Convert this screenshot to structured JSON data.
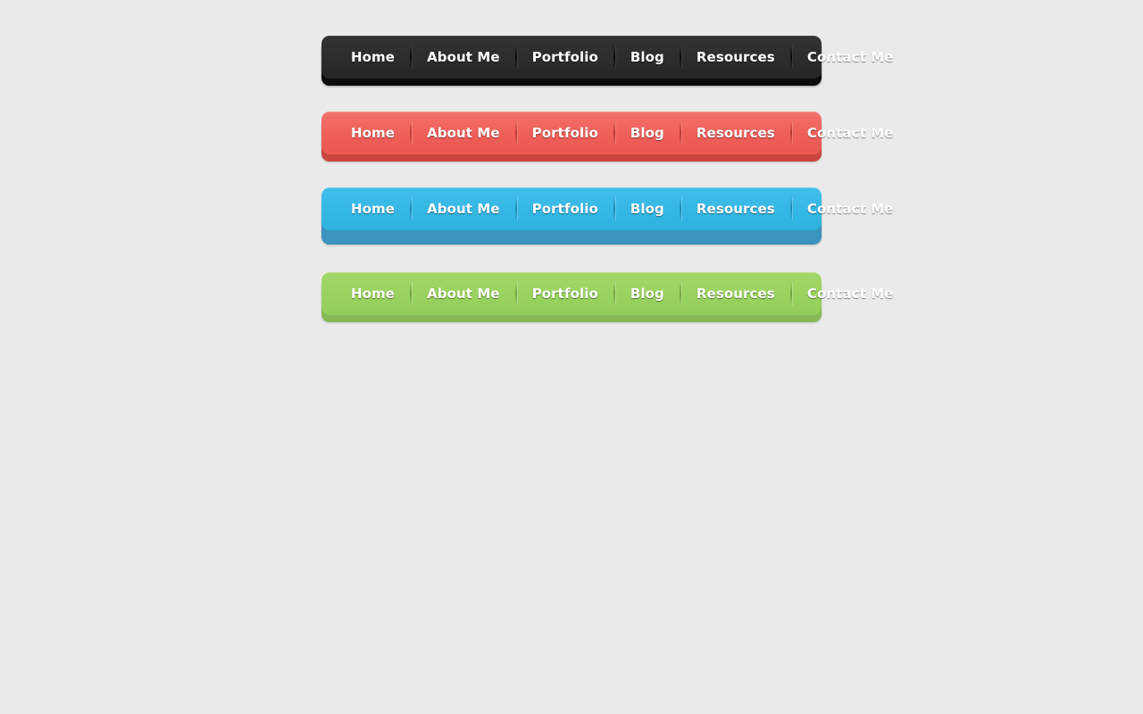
{
  "page": {
    "background_color": "#eaeaea"
  },
  "navbars": [
    {
      "id": "dark",
      "theme_name": "dark",
      "colors": {
        "body_top": "#333333",
        "body_bottom": "#262626",
        "base_strip": "#0c0c0c",
        "text": "#ffffff"
      },
      "items": [
        {
          "label": "Home"
        },
        {
          "label": "About Me"
        },
        {
          "label": "Portfolio"
        },
        {
          "label": "Blog"
        },
        {
          "label": "Resources"
        },
        {
          "label": "Contact Me"
        }
      ]
    },
    {
      "id": "red",
      "theme_name": "red",
      "colors": {
        "body_top": "#f4726c",
        "body_bottom": "#e95750",
        "base_strip": "#c9443e",
        "text": "#ffffff"
      },
      "items": [
        {
          "label": "Home"
        },
        {
          "label": "About Me"
        },
        {
          "label": "Portfolio"
        },
        {
          "label": "Blog"
        },
        {
          "label": "Resources"
        },
        {
          "label": "Contact Me"
        }
      ]
    },
    {
      "id": "blue",
      "theme_name": "blue",
      "colors": {
        "body_top": "#43bfec",
        "body_bottom": "#2fb2de",
        "base_strip": "#3a94bd",
        "text": "#ffffff"
      },
      "items": [
        {
          "label": "Home"
        },
        {
          "label": "About Me"
        },
        {
          "label": "Portfolio"
        },
        {
          "label": "Blog"
        },
        {
          "label": "Resources"
        },
        {
          "label": "Contact Me"
        }
      ]
    },
    {
      "id": "green",
      "theme_name": "green",
      "colors": {
        "body_top": "#a3d768",
        "body_bottom": "#92cd59",
        "base_strip": "#87b857",
        "text": "#ffffff"
      },
      "items": [
        {
          "label": "Home"
        },
        {
          "label": "About Me"
        },
        {
          "label": "Portfolio"
        },
        {
          "label": "Blog"
        },
        {
          "label": "Resources"
        },
        {
          "label": "Contact Me"
        }
      ]
    }
  ]
}
